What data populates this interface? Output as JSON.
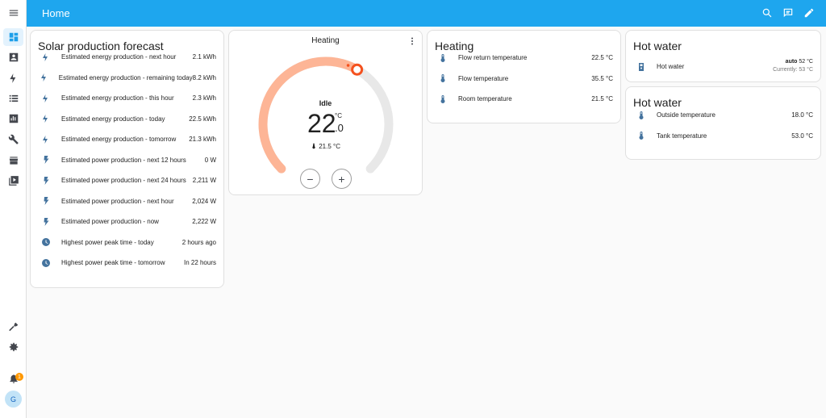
{
  "header": {
    "title": "Home"
  },
  "sidebar": {
    "items": [
      {
        "name": "overview",
        "icon": "dashboard-icon"
      },
      {
        "name": "map",
        "icon": "account-box-icon"
      },
      {
        "name": "energy",
        "icon": "lightning-icon"
      },
      {
        "name": "logbook",
        "icon": "list-icon"
      },
      {
        "name": "history",
        "icon": "chart-icon"
      },
      {
        "name": "settings-tools",
        "icon": "wrench-icon"
      },
      {
        "name": "store",
        "icon": "store-icon"
      },
      {
        "name": "media",
        "icon": "media-icon"
      }
    ],
    "notification_count": "1",
    "avatar_initial": "G"
  },
  "solar": {
    "title": "Solar production forecast",
    "rows": [
      {
        "icon": "lightning-icon",
        "label": "Estimated energy production - next hour",
        "value": "2.1 kWh"
      },
      {
        "icon": "lightning-icon",
        "label": "Estimated energy production - remaining today",
        "value": "8.2 kWh"
      },
      {
        "icon": "lightning-icon",
        "label": "Estimated energy production - this hour",
        "value": "2.3 kWh"
      },
      {
        "icon": "lightning-icon",
        "label": "Estimated energy production - today",
        "value": "22.5 kWh"
      },
      {
        "icon": "lightning-icon",
        "label": "Estimated energy production - tomorrow",
        "value": "21.3 kWh"
      },
      {
        "icon": "power-icon",
        "label": "Estimated power production - next 12 hours",
        "value": "0 W"
      },
      {
        "icon": "power-icon",
        "label": "Estimated power production - next 24 hours",
        "value": "2,211 W"
      },
      {
        "icon": "power-icon",
        "label": "Estimated power production - next hour",
        "value": "2,024 W"
      },
      {
        "icon": "power-icon",
        "label": "Estimated power production - now",
        "value": "2,222 W"
      },
      {
        "icon": "clock-icon",
        "label": "Highest power peak time - today",
        "value": "2 hours ago"
      },
      {
        "icon": "clock-icon",
        "label": "Highest power peak time - tomorrow",
        "value": "In 22 hours"
      }
    ]
  },
  "thermostat": {
    "title": "Heating",
    "state": "Idle",
    "target_int": "22",
    "target_dec": ".0",
    "unit": "°C",
    "current": "21.5 °C",
    "minus": "−",
    "plus": "+",
    "setpoint_fraction": 0.61,
    "colors": {
      "track": "#e8e8e8",
      "active": "#fdb596",
      "accent": "#f4511e"
    }
  },
  "heating": {
    "title": "Heating",
    "rows": [
      {
        "label": "Flow return temperature",
        "value": "22.5 °C"
      },
      {
        "label": "Flow temperature",
        "value": "35.5 °C"
      },
      {
        "label": "Room temperature",
        "value": "21.5 °C"
      }
    ]
  },
  "hotwater1": {
    "title": "Hot water",
    "row": {
      "label": "Hot water",
      "mode": "auto",
      "setpoint": "52 °C",
      "current": "Currently: 53 °C"
    }
  },
  "hotwater2": {
    "title": "Hot water",
    "rows": [
      {
        "label": "Outside temperature",
        "value": "18.0 °C"
      },
      {
        "label": "Tank temperature",
        "value": "53.0 °C"
      }
    ]
  },
  "colors": {
    "accent": "#1ea6ee",
    "icon": "#44739e"
  }
}
